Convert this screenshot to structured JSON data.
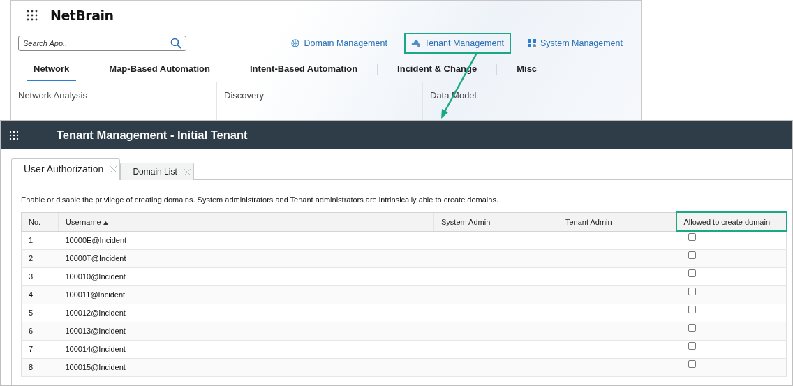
{
  "launcher": {
    "logo": "NetBrain",
    "search": {
      "placeholder": "Search App.."
    },
    "links": [
      {
        "label": "Domain Management",
        "highlighted": false
      },
      {
        "label": "Tenant Management",
        "highlighted": true
      },
      {
        "label": "System Management",
        "highlighted": false
      }
    ],
    "tabs": [
      {
        "label": "Network",
        "selected": true
      },
      {
        "label": "Map-Based Automation",
        "selected": false
      },
      {
        "label": "Intent-Based Automation",
        "selected": false
      },
      {
        "label": "Incident & Change",
        "selected": false
      },
      {
        "label": "Misc",
        "selected": false
      }
    ],
    "sections": [
      {
        "title": "Network Analysis"
      },
      {
        "title": "Discovery"
      },
      {
        "title": "Data Model"
      }
    ]
  },
  "window": {
    "title": "Tenant Management - Initial Tenant",
    "tabs": [
      {
        "label": "User Authorization",
        "selected": true
      },
      {
        "label": "Domain List",
        "selected": false
      }
    ],
    "description": "Enable or disable the privilege of creating domains. System administrators and Tenant administrators are intrinsically able to create domains.",
    "table": {
      "columns": [
        {
          "label": "No.",
          "sorted": false,
          "highlighted": false
        },
        {
          "label": "Username",
          "sorted": true,
          "highlighted": false
        },
        {
          "label": "System Admin",
          "sorted": false,
          "highlighted": false
        },
        {
          "label": "Tenant Admin",
          "sorted": false,
          "highlighted": false
        },
        {
          "label": "Allowed to create domain",
          "sorted": false,
          "highlighted": true
        }
      ],
      "rows": [
        {
          "no": "1",
          "username": "10000E@Incident",
          "allowed": false
        },
        {
          "no": "2",
          "username": "10000T@Incident",
          "allowed": false
        },
        {
          "no": "3",
          "username": "100010@Incident",
          "allowed": false
        },
        {
          "no": "4",
          "username": "100011@Incident",
          "allowed": false
        },
        {
          "no": "5",
          "username": "100012@Incident",
          "allowed": false
        },
        {
          "no": "6",
          "username": "100013@Incident",
          "allowed": false
        },
        {
          "no": "7",
          "username": "100014@Incident",
          "allowed": false
        },
        {
          "no": "8",
          "username": "100015@Incident",
          "allowed": false
        }
      ]
    }
  }
}
